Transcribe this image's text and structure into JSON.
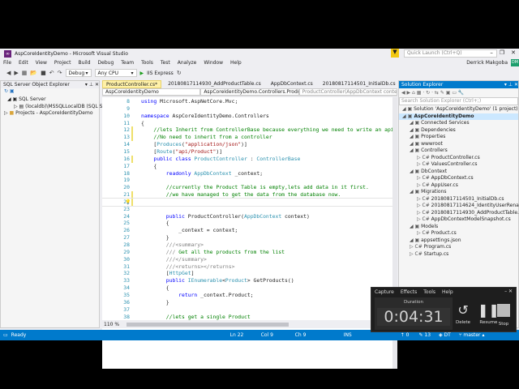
{
  "window": {
    "title": "AspCoreIdentityDemo - Microsoft Visual Studio",
    "quick_launch_placeholder": "Quick Launch (Ctrl+Q)",
    "user": "Derrick Makgoba",
    "avatar": "DM"
  },
  "menu": [
    "File",
    "Edit",
    "View",
    "Project",
    "Build",
    "Debug",
    "Team",
    "Tools",
    "Test",
    "Analyze",
    "Window",
    "Help"
  ],
  "toolbar": {
    "config": "Debug",
    "platform": "Any CPU",
    "run": "IIS Express"
  },
  "sql_explorer": {
    "title": "SQL Server Object Explorer",
    "items": [
      "SQL Server",
      "(localdb)\\MSSQLLocalDB (SQL Se",
      "Projects - AspCoreIdentityDemo"
    ]
  },
  "tabs": [
    "ProductController.cs*",
    "20180817114930_AddProductTable.cs",
    "AppDbContext.cs",
    "20180817114501_InitialDb.cs"
  ],
  "navbar": [
    "AspCoreIdentityDemo",
    "AspCoreIdentityDemo.Controllers.Produc",
    "ProductController(AppDbContext context)"
  ],
  "code": [
    {
      "n": "8",
      "t": [
        [
          "k",
          "using"
        ],
        [
          "",
          "Microsoft.AspNetCore.Mvc;"
        ]
      ]
    },
    {
      "n": "9",
      "t": []
    },
    {
      "n": "10",
      "t": [
        [
          "k",
          "namespace"
        ],
        [
          "",
          "AspCoreIdentityDemo.Controllers"
        ]
      ]
    },
    {
      "n": "11",
      "t": [
        [
          "",
          "{"
        ]
      ]
    },
    {
      "n": "12",
      "t": [
        [
          "c",
          "    //lets Inherit from ControllerBase because everything we need to write an api i"
        ]
      ]
    },
    {
      "n": "13",
      "t": [
        [
          "c",
          "    //No need to inherit from a controller"
        ]
      ]
    },
    {
      "n": "14",
      "t": [
        [
          "",
          "    ["
        ],
        [
          "t",
          "Produces"
        ],
        [
          "",
          "("
        ],
        [
          "s",
          "\"application/json\""
        ],
        [
          "",
          ")]"
        ]
      ]
    },
    {
      "n": "15",
      "t": [
        [
          "",
          "    ["
        ],
        [
          "t",
          "Route"
        ],
        [
          "",
          "("
        ],
        [
          "s",
          "\"api/Product\""
        ],
        [
          "",
          ")]"
        ]
      ]
    },
    {
      "n": "16",
      "t": [
        [
          "k",
          "    public class"
        ],
        [
          "t",
          "ProductController"
        ],
        [
          "",
          ":"
        ],
        [
          "t",
          "ControllerBase"
        ]
      ]
    },
    {
      "n": "17",
      "t": [
        [
          "",
          "    {"
        ]
      ]
    },
    {
      "n": "18",
      "t": [
        [
          "k",
          "        readonly"
        ],
        [
          "t",
          "AppDbContext"
        ],
        [
          "",
          "_context;"
        ]
      ]
    },
    {
      "n": "19",
      "t": []
    },
    {
      "n": "20",
      "t": [
        [
          "c",
          "        //currently the Product Table is empty,lets add data in it first."
        ]
      ]
    },
    {
      "n": "21",
      "t": [
        [
          "c",
          "        //we have managed to get the data from the database now."
        ]
      ]
    },
    {
      "n": "22",
      "t": []
    },
    {
      "n": "23",
      "t": []
    },
    {
      "n": "24",
      "t": [
        [
          "k",
          "        public"
        ],
        [
          "",
          "ProductController("
        ],
        [
          "t",
          "AppDbContext"
        ],
        [
          "",
          "context)"
        ]
      ]
    },
    {
      "n": "25",
      "t": [
        [
          "",
          "        {"
        ]
      ]
    },
    {
      "n": "26",
      "t": [
        [
          "",
          "            _context = context;"
        ]
      ]
    },
    {
      "n": "27",
      "t": [
        [
          "",
          "        }"
        ]
      ]
    },
    {
      "n": "28",
      "t": [
        [
          "g",
          "        ///"
        ],
        [
          "g",
          "<summary>"
        ]
      ]
    },
    {
      "n": "29",
      "t": [
        [
          "g",
          "        ///"
        ],
        [
          "c",
          "Get all the products from the list"
        ]
      ]
    },
    {
      "n": "30",
      "t": [
        [
          "g",
          "        ///"
        ],
        [
          "g",
          "</summary>"
        ]
      ]
    },
    {
      "n": "31",
      "t": [
        [
          "g",
          "        ///"
        ],
        [
          "g",
          "<returns></returns>"
        ]
      ]
    },
    {
      "n": "32",
      "t": [
        [
          "",
          "        ["
        ],
        [
          "t",
          "HttpGet"
        ],
        [
          "",
          "]"
        ]
      ]
    },
    {
      "n": "33",
      "t": [
        [
          "k",
          "        public"
        ],
        [
          "t",
          "IEnumerable"
        ],
        [
          "",
          "<"
        ],
        [
          "t",
          "Product"
        ],
        [
          "",
          "> GetProducts()"
        ]
      ]
    },
    {
      "n": "34",
      "t": [
        [
          "",
          "        {"
        ]
      ]
    },
    {
      "n": "35",
      "t": [
        [
          "k",
          "            return"
        ],
        [
          "",
          "_context.Product;"
        ]
      ]
    },
    {
      "n": "36",
      "t": [
        [
          "",
          "        }"
        ]
      ]
    },
    {
      "n": "37",
      "t": []
    },
    {
      "n": "38",
      "t": [
        [
          "c",
          "        //lets get a single Product"
        ]
      ]
    },
    {
      "n": "39",
      "t": []
    }
  ],
  "zoom": "110 %",
  "solution_explorer": {
    "title": "Solution Explorer",
    "search_placeholder": "Search Solution Explorer (Ctrl+;)",
    "items": [
      {
        "d": 0,
        "label": "Solution 'AspCoreIdentityDemo' (1 project)"
      },
      {
        "d": 0,
        "label": "AspCoreIdentityDemo",
        "bold": true
      },
      {
        "d": 1,
        "label": "Connected Services"
      },
      {
        "d": 1,
        "label": "Dependencies"
      },
      {
        "d": 1,
        "label": "Properties"
      },
      {
        "d": 1,
        "label": "wwwroot"
      },
      {
        "d": 1,
        "label": "Controllers"
      },
      {
        "d": 2,
        "label": "ProductController.cs"
      },
      {
        "d": 2,
        "label": "ValuesController.cs"
      },
      {
        "d": 1,
        "label": "DbContext"
      },
      {
        "d": 2,
        "label": "AppDbContext.cs"
      },
      {
        "d": 2,
        "label": "AppUser.cs"
      },
      {
        "d": 1,
        "label": "Migrations"
      },
      {
        "d": 2,
        "label": "20180817114501_InitialDb.cs"
      },
      {
        "d": 2,
        "label": "20180817114624_IdentityUserRenamed.cs"
      },
      {
        "d": 2,
        "label": "20180817114930_AddProductTable.cs"
      },
      {
        "d": 2,
        "label": "AppDbContextModelSnapshot.cs"
      },
      {
        "d": 1,
        "label": "Models"
      },
      {
        "d": 2,
        "label": "Product.cs"
      },
      {
        "d": 1,
        "label": "appsettings.json"
      },
      {
        "d": 1,
        "label": "Program.cs"
      },
      {
        "d": 1,
        "label": "Startup.cs"
      }
    ]
  },
  "status": {
    "ready": "Ready",
    "ln": "Ln 22",
    "col": "Col 9",
    "ch": "Ch 9",
    "mode": "INS",
    "up": "0",
    "pencil": "13",
    "repo": "DT",
    "branch": "master"
  },
  "recorder": {
    "menu": [
      "Capture",
      "Effects",
      "Tools",
      "Help"
    ],
    "duration_label": "Duration",
    "time": "0:04:31",
    "delete": "Delete",
    "resume": "Resume",
    "stop": "Stop"
  }
}
